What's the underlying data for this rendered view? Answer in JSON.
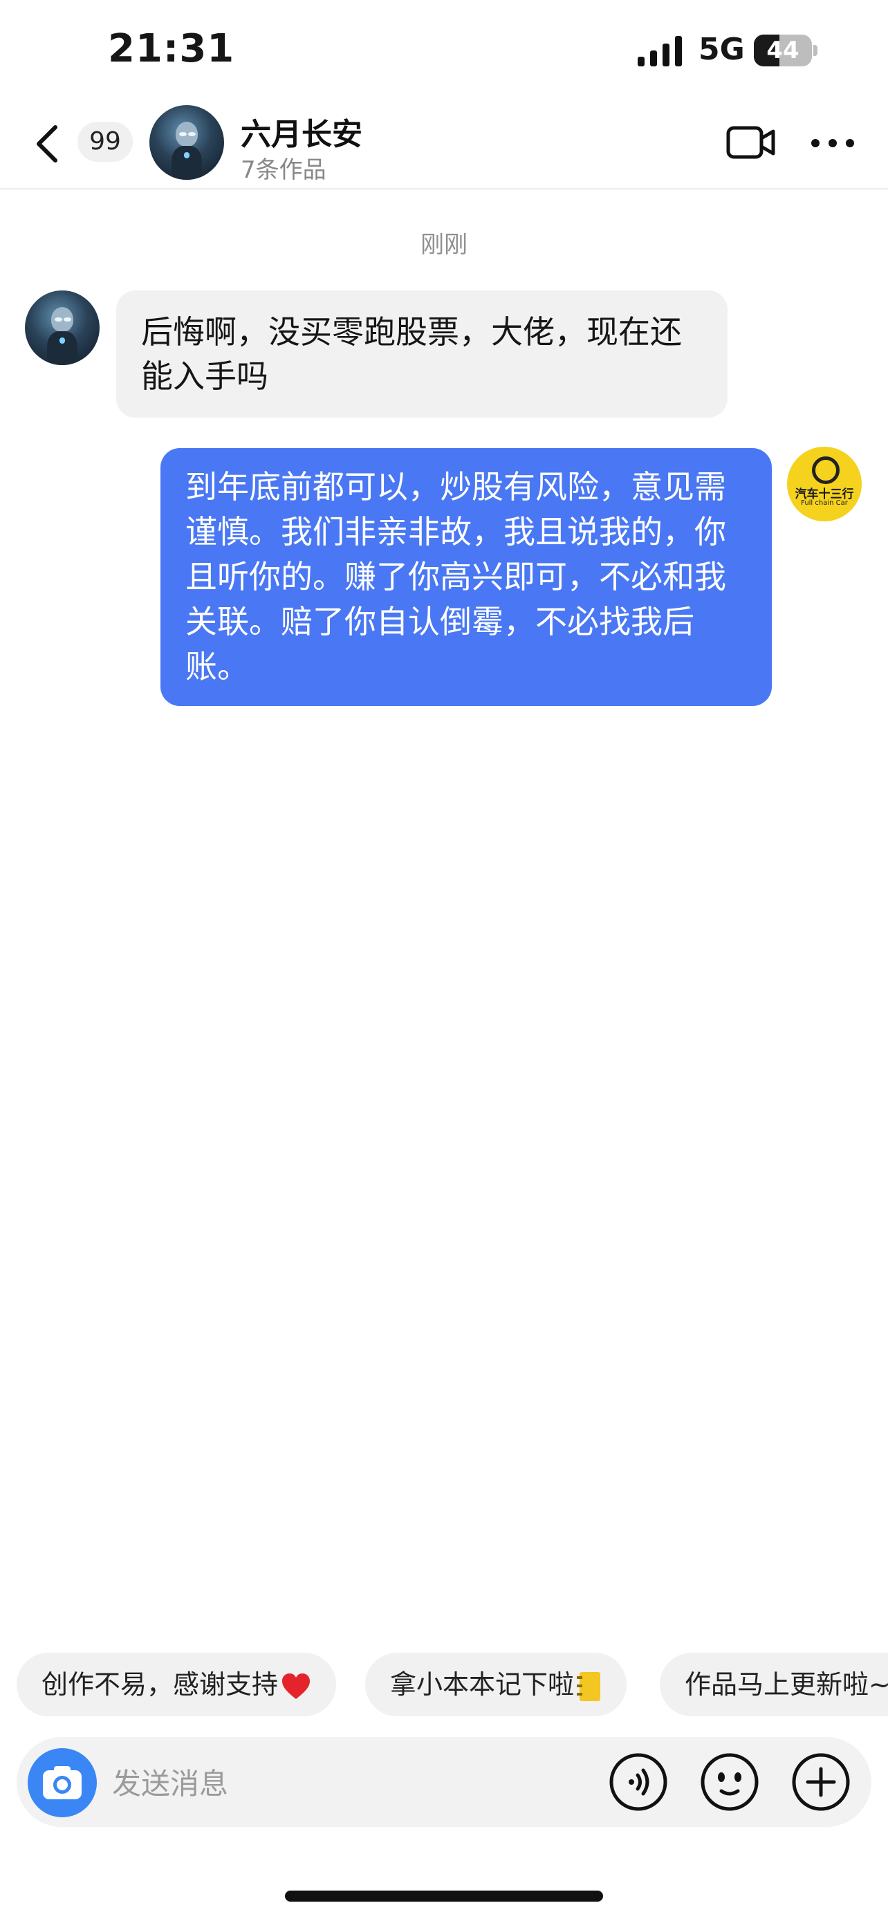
{
  "status_bar": {
    "time": "21:31",
    "network": "5G",
    "battery": "44",
    "battery_level": 0.44
  },
  "header": {
    "back_icon": "chevron-left-icon",
    "unread_count": "99",
    "contact_name": "六月长安",
    "works_count": "7条作品",
    "video_icon": "video-camera-icon",
    "more_icon": "more-dots-icon"
  },
  "chat": {
    "timestamp": "刚刚",
    "messages": [
      {
        "direction": "incoming",
        "text": "后悔啊，没买零跑股票，大佬，现在还能入手吗"
      },
      {
        "direction": "outgoing",
        "text": "到年底前都可以，炒股有风险，意见需谨慎。我们非亲非故，我且说我的，你且听你的。赚了你高兴即可，不必和我关联。赔了你自认倒霉，不必找我后账。"
      }
    ],
    "outgoing_avatar": {
      "logo_text": "汽车十三行",
      "logo_subtext": "Full chain Car"
    }
  },
  "quick_replies": [
    {
      "label": "创作不易，感谢支持",
      "emoji_icon": "red-heart-icon"
    },
    {
      "label": "拿小本本记下啦",
      "emoji_icon": "notebook-icon"
    },
    {
      "label": "作品马上更新啦~",
      "emoji_icon": ""
    }
  ],
  "input_bar": {
    "camera_icon": "camera-icon",
    "placeholder": "发送消息",
    "value": "",
    "voice_icon": "voice-icon",
    "emoji_icon": "smiley-icon",
    "plus_icon": "plus-icon"
  },
  "colors": {
    "outgoing_bubble": "#4a78f4",
    "incoming_bubble": "#f1f1f1",
    "camera_button": "#3b86f5",
    "avatar_yellow": "#f5d21e"
  }
}
